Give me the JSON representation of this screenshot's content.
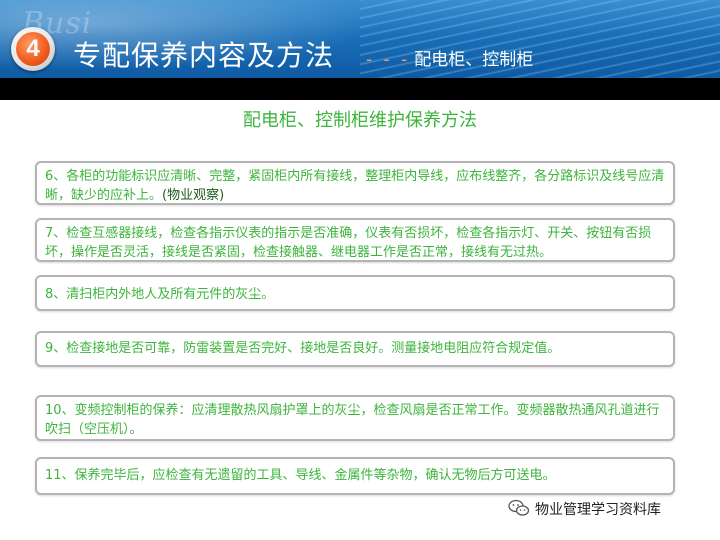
{
  "header": {
    "number": "4",
    "watermark": "Busi",
    "title": "专配保养内容及方法",
    "subtitle_dashes": "- - -",
    "subtitle": "配电柜、控制柜"
  },
  "section_heading": "配电柜、控制柜维护保养方法",
  "items": [
    {
      "text": "6、各柜的功能标识应清晰、完整，紧固柜内所有接线，整理柜内导线，应布线整齐，各分路标识及线号应清晰，缺少的应补上。",
      "note": "(物业观察)"
    },
    {
      "text": "7、检查互感器接线，检查各指示仪表的指示是否准确，仪表有否损坏，检查各指示灯、开关、按钮有否损坏，操作是否灵活，接线是否紧固，检查接触器、继电器工作是否正常，接线有无过热。"
    },
    {
      "text": "8、清扫柜内外地人及所有元件的灰尘。"
    },
    {
      "text": "9、检查接地是否可靠，防雷装置是否完好、接地是否良好。测量接地电阻应符合规定值。"
    },
    {
      "text": "10、变频控制柜的保养：应清理散热风扇护罩上的灰尘，检查风扇是否正常工作。变频器散热通风孔道进行吹扫（空压机）。"
    },
    {
      "text": "11、保养完毕后，应检查有无遗留的工具、导线、金属件等杂物，确认无物后方可送电。"
    }
  ],
  "footer": {
    "logo_icon": "wechat-icon",
    "label": "物业管理学习资料库"
  }
}
